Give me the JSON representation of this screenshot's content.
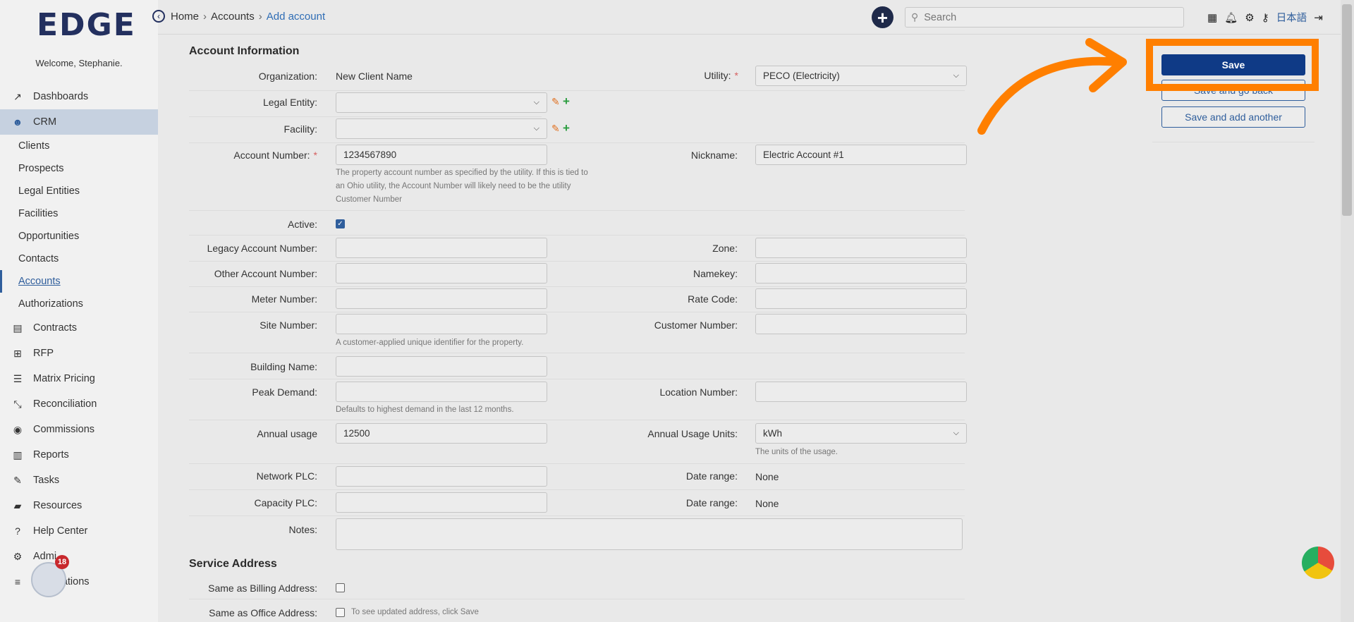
{
  "app": {
    "logo": "EDGE",
    "welcome": "Welcome, Stephanie."
  },
  "sidebar": {
    "items": [
      {
        "label": "Dashboards",
        "icon": "chart-line-icon"
      },
      {
        "label": "CRM",
        "icon": "users-icon",
        "active": true
      },
      {
        "label": "Contracts",
        "icon": "document-icon"
      },
      {
        "label": "RFP",
        "icon": "sitemap-icon"
      },
      {
        "label": "Matrix Pricing",
        "icon": "list-icon"
      },
      {
        "label": "Reconciliation",
        "icon": "compress-icon"
      },
      {
        "label": "Commissions",
        "icon": "coins-icon"
      },
      {
        "label": "Reports",
        "icon": "bar-chart-icon"
      },
      {
        "label": "Tasks",
        "icon": "tasks-icon"
      },
      {
        "label": "Resources",
        "icon": "folder-icon"
      },
      {
        "label": "Help Center",
        "icon": "question-icon"
      },
      {
        "label": "Admi",
        "icon": "cogs-icon"
      },
      {
        "label": "rations",
        "icon": "sliders-icon"
      }
    ],
    "crm_sub": [
      "Clients",
      "Prospects",
      "Legal Entities",
      "Facilities",
      "Opportunities",
      "Contacts",
      "Accounts",
      "Authorizations"
    ],
    "badge_count": "18"
  },
  "header": {
    "breadcrumb": [
      "Home",
      "Accounts",
      "Add account"
    ],
    "search_placeholder": "Search",
    "language": "日本語"
  },
  "form": {
    "section_account": "Account Information",
    "section_service": "Service Address",
    "organization_label": "Organization:",
    "organization_value": "New Client Name",
    "utility_label": "Utility:",
    "utility_value": "PECO (Electricity)",
    "legal_entity_label": "Legal Entity:",
    "facility_label": "Facility:",
    "account_number_label": "Account Number:",
    "account_number_value": "1234567890",
    "account_number_help": "The property account number as specified by the utility. If this is tied to an Ohio utility, the Account Number will likely need to be the utility Customer Number",
    "nickname_label": "Nickname:",
    "nickname_value": "Electric Account #1",
    "active_label": "Active:",
    "legacy_label": "Legacy Account Number:",
    "zone_label": "Zone:",
    "other_label": "Other Account Number:",
    "namekey_label": "Namekey:",
    "meter_label": "Meter Number:",
    "rate_label": "Rate Code:",
    "site_label": "Site Number:",
    "site_help": "A customer-applied unique identifier for the property.",
    "customer_label": "Customer Number:",
    "building_label": "Building Name:",
    "peak_label": "Peak Demand:",
    "peak_help": "Defaults to highest demand in the last 12 months.",
    "location_label": "Location Number:",
    "annual_label": "Annual usage",
    "annual_value": "12500",
    "units_label": "Annual Usage Units:",
    "units_value": "kWh",
    "units_help": "The units of the usage.",
    "network_label": "Network PLC:",
    "capacity_label": "Capacity PLC:",
    "date_range_label": "Date range:",
    "date_range_value_1": "None",
    "date_range_value_2": "None",
    "notes_label": "Notes:",
    "same_billing_label": "Same as Billing Address:",
    "same_office_label": "Same as Office Address:",
    "same_office_help": "To see updated address, click Save"
  },
  "actions": {
    "save": "Save",
    "save_back": "Save and go back",
    "save_add": "Save and add another"
  },
  "colors": {
    "highlight": "#ff7f00",
    "primary": "#0f3a86",
    "accent": "#2f5e9c"
  }
}
